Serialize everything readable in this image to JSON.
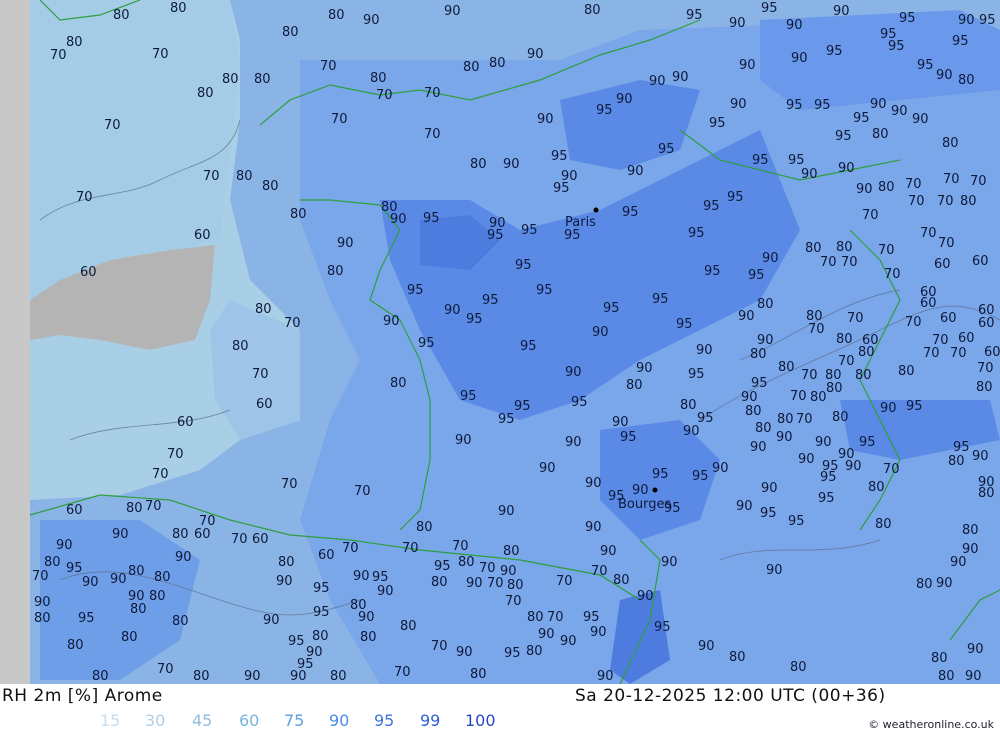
{
  "footer": {
    "product": "RH 2m [%] Arome",
    "valid_time": "Sa 20-12-2025 12:00 UTC (00+36)",
    "credit": "© weatheronline.co.uk"
  },
  "legend": [
    {
      "label": "15",
      "color": "#c8dceb"
    },
    {
      "label": "30",
      "color": "#b0cde3"
    },
    {
      "label": "45",
      "color": "#94bcdc"
    },
    {
      "label": "60",
      "color": "#78b4e0"
    },
    {
      "label": "75",
      "color": "#5a9fe0"
    },
    {
      "label": "90",
      "color": "#4b8de4"
    },
    {
      "label": "95",
      "color": "#3d75df"
    },
    {
      "label": "99",
      "color": "#2f5ed6"
    },
    {
      "label": "100",
      "color": "#2747c8"
    }
  ],
  "cities": [
    {
      "name": "Paris"
    },
    {
      "name": "Bourges"
    }
  ],
  "contour_labels": [
    "60",
    "70",
    "80",
    "90",
    "95"
  ]
}
